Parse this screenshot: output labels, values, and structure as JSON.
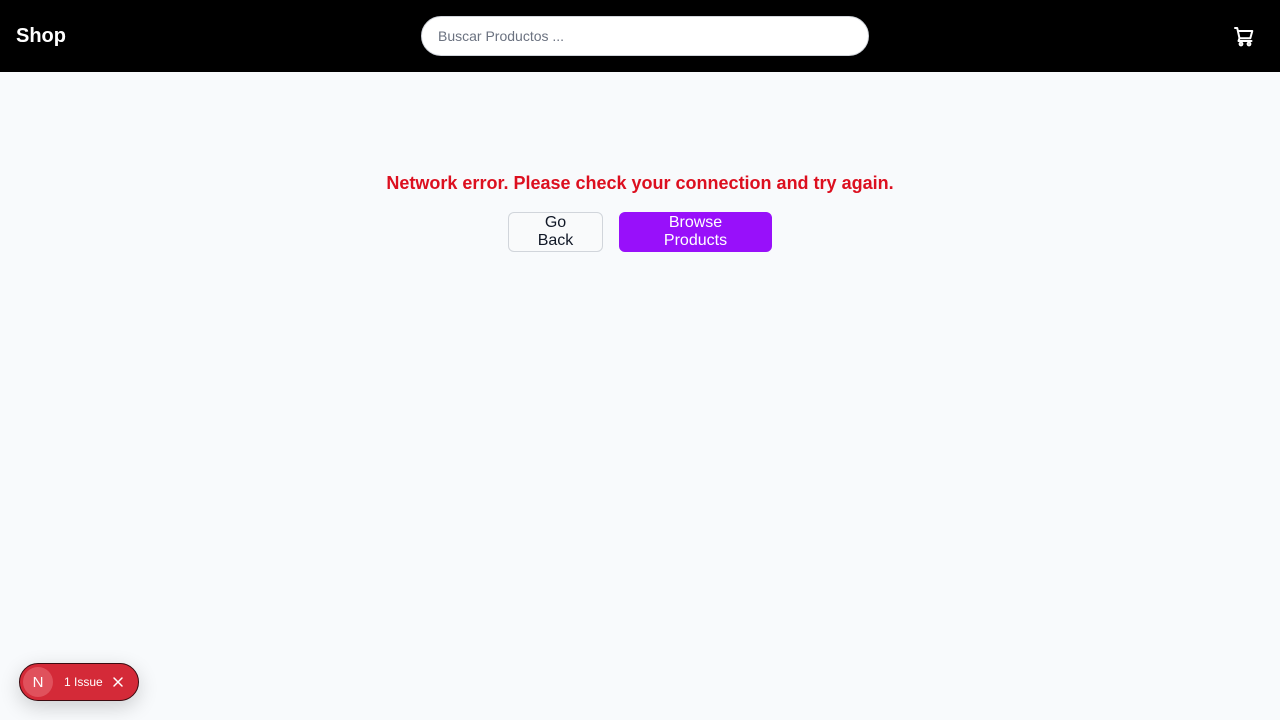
{
  "header": {
    "brand": "Shop",
    "search_placeholder": "Buscar Productos ...",
    "cart_icon": "shopping-cart-icon"
  },
  "main": {
    "error_message": "Network error. Please check your connection and try again.",
    "go_back_label": "Go Back",
    "browse_products_label": "Browse Products"
  },
  "dev_overlay": {
    "logo_letter": "N",
    "issue_label": "1 Issue",
    "close_icon": "close-icon"
  },
  "colors": {
    "navbar_bg": "#000000",
    "page_bg": "#f8fafc",
    "error_text": "#dc0f1f",
    "accent": "#9810fa",
    "issue_badge": "#d42a38"
  }
}
